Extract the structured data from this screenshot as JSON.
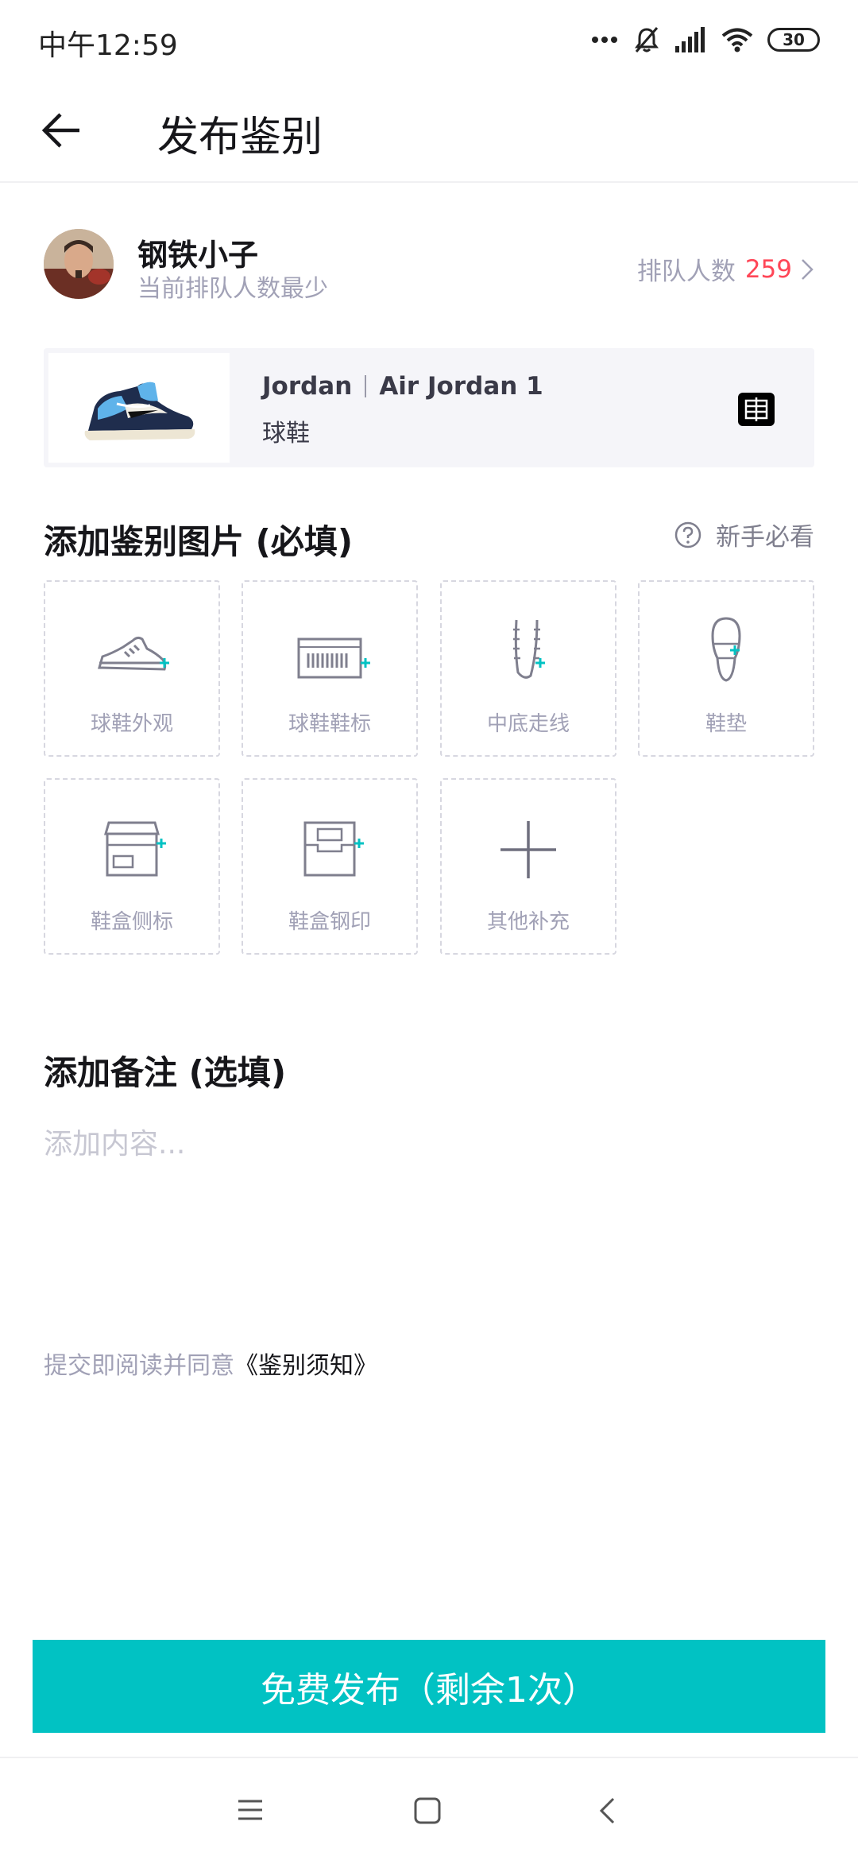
{
  "status_bar": {
    "time": "中午12:59",
    "battery": "30",
    "icons": [
      "more-dots-icon",
      "mute-bell-icon",
      "signal-icon",
      "wifi-icon",
      "battery-icon"
    ]
  },
  "header": {
    "title": "发布鉴别",
    "back_icon": "back-arrow-icon"
  },
  "user": {
    "name": "钢铁小子",
    "subtitle": "当前排队人数最少",
    "queue_label": "排队人数",
    "queue_count": "259"
  },
  "product": {
    "brand": "Jordan",
    "series": "Air Jordan 1",
    "category": "球鞋"
  },
  "photos_section": {
    "title": "添加鉴别图片 (必填)",
    "guide_label": "新手必看",
    "items": [
      {
        "label": "球鞋外观",
        "icon": "sneaker-side-icon"
      },
      {
        "label": "球鞋鞋标",
        "icon": "shoe-label-barcode-icon"
      },
      {
        "label": "中底走线",
        "icon": "midsole-stitch-icon"
      },
      {
        "label": "鞋垫",
        "icon": "insole-icon"
      },
      {
        "label": "鞋盒侧标",
        "icon": "box-side-label-icon"
      },
      {
        "label": "鞋盒钢印",
        "icon": "box-stamp-icon"
      },
      {
        "label": "其他补充",
        "icon": "plus-icon"
      }
    ]
  },
  "remark_section": {
    "title": "添加备注 (选填)",
    "placeholder": "添加内容..."
  },
  "agreement": {
    "prefix": "提交即阅读并同意",
    "link": "《鉴别须知》"
  },
  "publish_button": {
    "label": "免费发布（剩余1次）"
  },
  "colors": {
    "accent": "#01C2C3",
    "queue_count": "#FF4657",
    "secondary_text": "#A1A1B6",
    "card_bg": "#F5F5F9"
  }
}
